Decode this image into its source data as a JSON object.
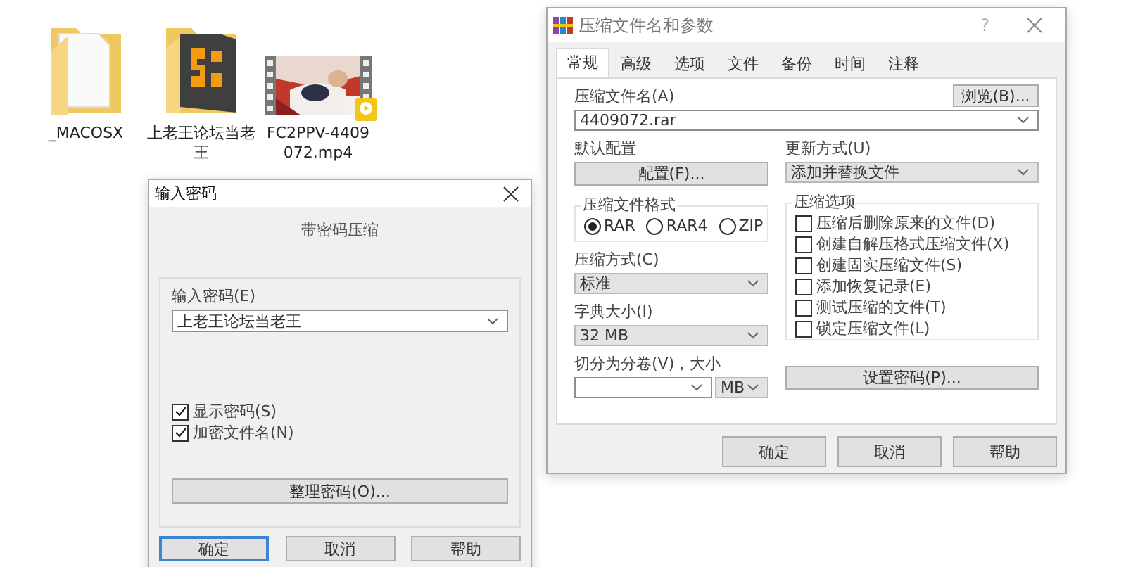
{
  "desktop_icons": [
    {
      "kind": "folder",
      "label": "_MACOSX"
    },
    {
      "kind": "app-folder",
      "label": "上老王论坛当老王"
    },
    {
      "kind": "video",
      "label": "FC2PPV-4409072.mp4"
    }
  ],
  "password_dialog": {
    "title": "输入密码",
    "heading": "带密码压缩",
    "password_label": "输入密码(E)",
    "password_value": "上老王论坛当老王",
    "options": [
      {
        "label": "显示密码(S)",
        "checked": true
      },
      {
        "label": "加密文件名(N)",
        "checked": true
      }
    ],
    "organize_button": "整理密码(O)...",
    "buttons": [
      {
        "label": "确定",
        "focused": true
      },
      {
        "label": "取消",
        "focused": false
      },
      {
        "label": "帮助",
        "focused": false
      }
    ]
  },
  "archive_dialog": {
    "title": "压缩文件名和参数",
    "help_glyph": "?",
    "tabs": [
      {
        "label": "常规",
        "selected": true
      },
      {
        "label": "高级",
        "selected": false
      },
      {
        "label": "选项",
        "selected": false
      },
      {
        "label": "文件",
        "selected": false
      },
      {
        "label": "备份",
        "selected": false
      },
      {
        "label": "时间",
        "selected": false
      },
      {
        "label": "注释",
        "selected": false
      }
    ],
    "archive_name_label": "压缩文件名(A)",
    "browse_button": "浏览(B)...",
    "archive_name": "4409072.rar",
    "profile_label": "默认配置",
    "profile_button": "配置(F)...",
    "update_label": "更新方式(U)",
    "update_value": "添加并替换文件",
    "format_group": "压缩文件格式",
    "formats": [
      {
        "label": "RAR",
        "selected": true
      },
      {
        "label": "RAR4",
        "selected": false
      },
      {
        "label": "ZIP",
        "selected": false
      }
    ],
    "method_label": "压缩方式(C)",
    "method_value": "标准",
    "dict_label": "字典大小(I)",
    "dict_value": "32 MB",
    "split_label": "切分为分卷(V)，大小",
    "split_unit": "MB",
    "options_group": "压缩选项",
    "options": [
      {
        "label": "压缩后删除原来的文件(D)",
        "checked": false
      },
      {
        "label": "创建自解压格式压缩文件(X)",
        "checked": false
      },
      {
        "label": "创建固实压缩文件(S)",
        "checked": false
      },
      {
        "label": "添加恢复记录(E)",
        "checked": false
      },
      {
        "label": "测试压缩的文件(T)",
        "checked": false
      },
      {
        "label": "锁定压缩文件(L)",
        "checked": false
      }
    ],
    "password_button": "设置密码(P)...",
    "buttons": [
      "确定",
      "取消",
      "帮助"
    ]
  }
}
